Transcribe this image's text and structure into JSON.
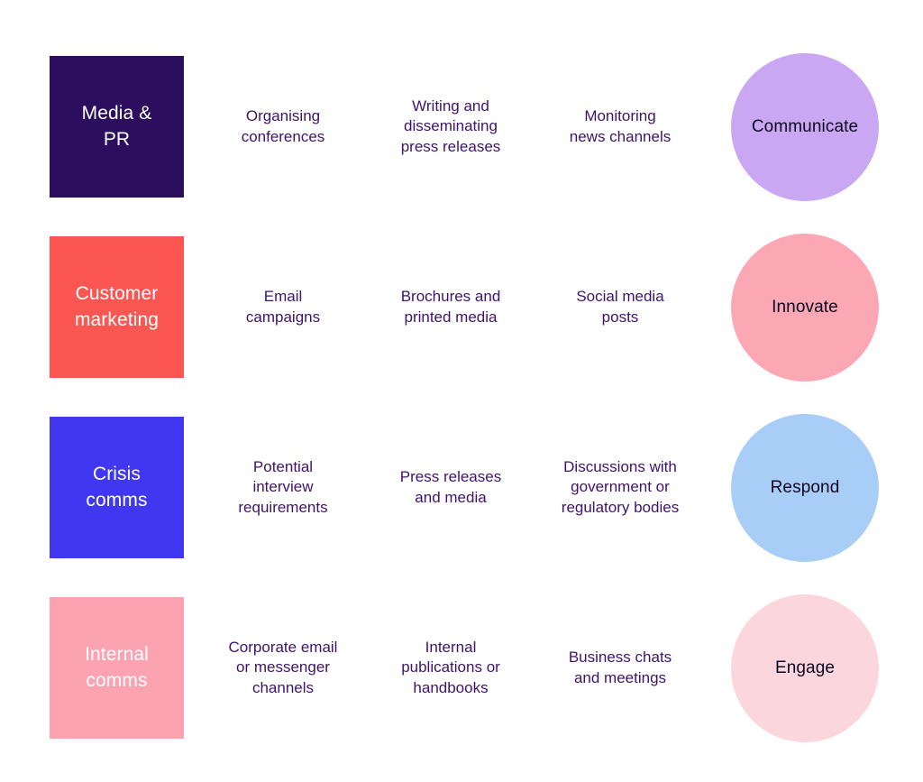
{
  "page": {
    "background": "#ffffff",
    "text_color_body": "#3d1469",
    "text_color_circle": "#0d0722",
    "text_color_tile": "#ffffff"
  },
  "rows": [
    {
      "tile": {
        "label": "Media &\nPR",
        "color": "#2c0e5e",
        "name": "media-and-pr"
      },
      "cells": [
        {
          "label": "Organising\nconferences"
        },
        {
          "label": "Writing and\ndisseminating\npress releases"
        },
        {
          "label": "Monitoring\nnews channels"
        }
      ],
      "circle": {
        "label": "Communicate",
        "color": "#c9a7f2",
        "name": "communicate"
      }
    },
    {
      "tile": {
        "label": "Customer\nmarketing",
        "color": "#fb5651",
        "name": "customer-marketing"
      },
      "cells": [
        {
          "label": "Email\ncampaigns"
        },
        {
          "label": "Brochures and\nprinted media"
        },
        {
          "label": "Social media\nposts"
        }
      ],
      "circle": {
        "label": "Innovate",
        "color": "#fca7b4",
        "name": "innovate"
      }
    },
    {
      "tile": {
        "label": "Crisis\ncomms",
        "color": "#4038f0",
        "name": "crisis-comms"
      },
      "cells": [
        {
          "label": "Potential\ninterview\nrequirements"
        },
        {
          "label": "Press releases\nand media"
        },
        {
          "label": "Discussions with\ngovernment or\nregulatory bodies"
        }
      ],
      "circle": {
        "label": "Respond",
        "color": "#a8cdf7",
        "name": "respond"
      }
    },
    {
      "tile": {
        "label": "Internal\ncomms",
        "color": "#fca3b2",
        "name": "internal-comms"
      },
      "cells": [
        {
          "label": "Corporate email\nor messenger\nchannels"
        },
        {
          "label": "Internal\npublications or\nhandbooks"
        },
        {
          "label": "Business chats\nand meetings"
        }
      ],
      "circle": {
        "label": "Engage",
        "color": "#fcd6dd",
        "name": "engage"
      }
    }
  ]
}
